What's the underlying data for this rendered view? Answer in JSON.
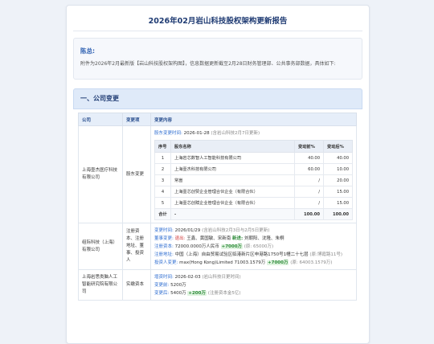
{
  "report": {
    "title": "2026年02月岩山科技股权架构更新报告"
  },
  "greeting": {
    "name": "陈总:",
    "body": "附件为2026年2月最新版【岩山科技股权架构图】，信息数据更新截至2月28日财务管理部、公共事务部数据，具体如下:"
  },
  "section": {
    "title": "一、公司变更"
  },
  "table": {
    "headers": {
      "company": "公司",
      "change_type": "变更项",
      "content": "变更内容"
    },
    "rows": [
      {
        "company": "上海壹杰医疗科技有限公司",
        "change_type": "股东变更",
        "meta_label": "股东变更时间:",
        "meta_date": "2026-01-28",
        "meta_note": "(含岩山科技2月7日更新)",
        "inner_headers": {
          "seq": "序号",
          "name": "股东名称",
          "before": "变动前%",
          "after": "变动后%"
        },
        "inner_rows": [
          {
            "seq": "1",
            "name": "上海岩芯数智人工智能科技有限公司",
            "before": "40.00",
            "after": "40.00"
          },
          {
            "seq": "2",
            "name": "上海壹杰科技有限公司",
            "before": "60.00",
            "after": "10.00"
          },
          {
            "seq": "3",
            "name": "常崮",
            "before": "/",
            "after": "20.00"
          },
          {
            "seq": "4",
            "name": "上海壹芯创赞企业管理合伙企业（有限合伙）",
            "before": "/",
            "after": "15.00"
          },
          {
            "seq": "5",
            "name": "上海壹芯创赋企业管理合伙企业（有限合伙）",
            "before": "/",
            "after": "15.00"
          }
        ],
        "total": {
          "label": "合计",
          "name": "-",
          "before": "100.00",
          "after": "100.00"
        }
      },
      {
        "company": "组际科技（上海）有限公司",
        "change_type": "注册资本、注册地址、董事、投资人",
        "l1_label": "变更时间:",
        "l1_date": "2026/01/29",
        "l1_note": "(含岩山科技2月3日与2月5日更新)",
        "l2_label": "董事变更:",
        "l2_out_label": "退出:",
        "l2_out": "王鑫、黄国敏、宋新南",
        "l2_in_label": "新进:",
        "l2_in": "刘朝阳、沈隆、朱桐",
        "l3_label": "注册资本:",
        "l3_value": "72000.0000万人民币",
        "l3_delta": "+7000万",
        "l3_prev": "(原: 65000万)",
        "l4_label": "注册地址:",
        "l4_value": "中国（上海）自由贸易试验区临港新片区申港路1750号1幢二十七层",
        "l4_prev": "(原:博霞路11号)",
        "l5_label": "投资人变更:",
        "l5_value": "max(Hong Kong)Limited",
        "l5_amount": "71003.1579万",
        "l5_delta": "+7000万",
        "l5_prev": "(原: 64003.1579万)"
      },
      {
        "company": "上海岩思类脑人工智能研究院有限公司",
        "change_type": "实缴资本",
        "l1_label": "增资时间:",
        "l1_date": "2026-02-03",
        "l1_note": "(岩山科技日更时间)",
        "l2_label": "变更前:",
        "l2_value": "5200万",
        "l3_label": "变更后:",
        "l3_value": "5400万",
        "l3_delta": "+200万",
        "l3_note": "(注册资本金5亿)"
      }
    ]
  }
}
